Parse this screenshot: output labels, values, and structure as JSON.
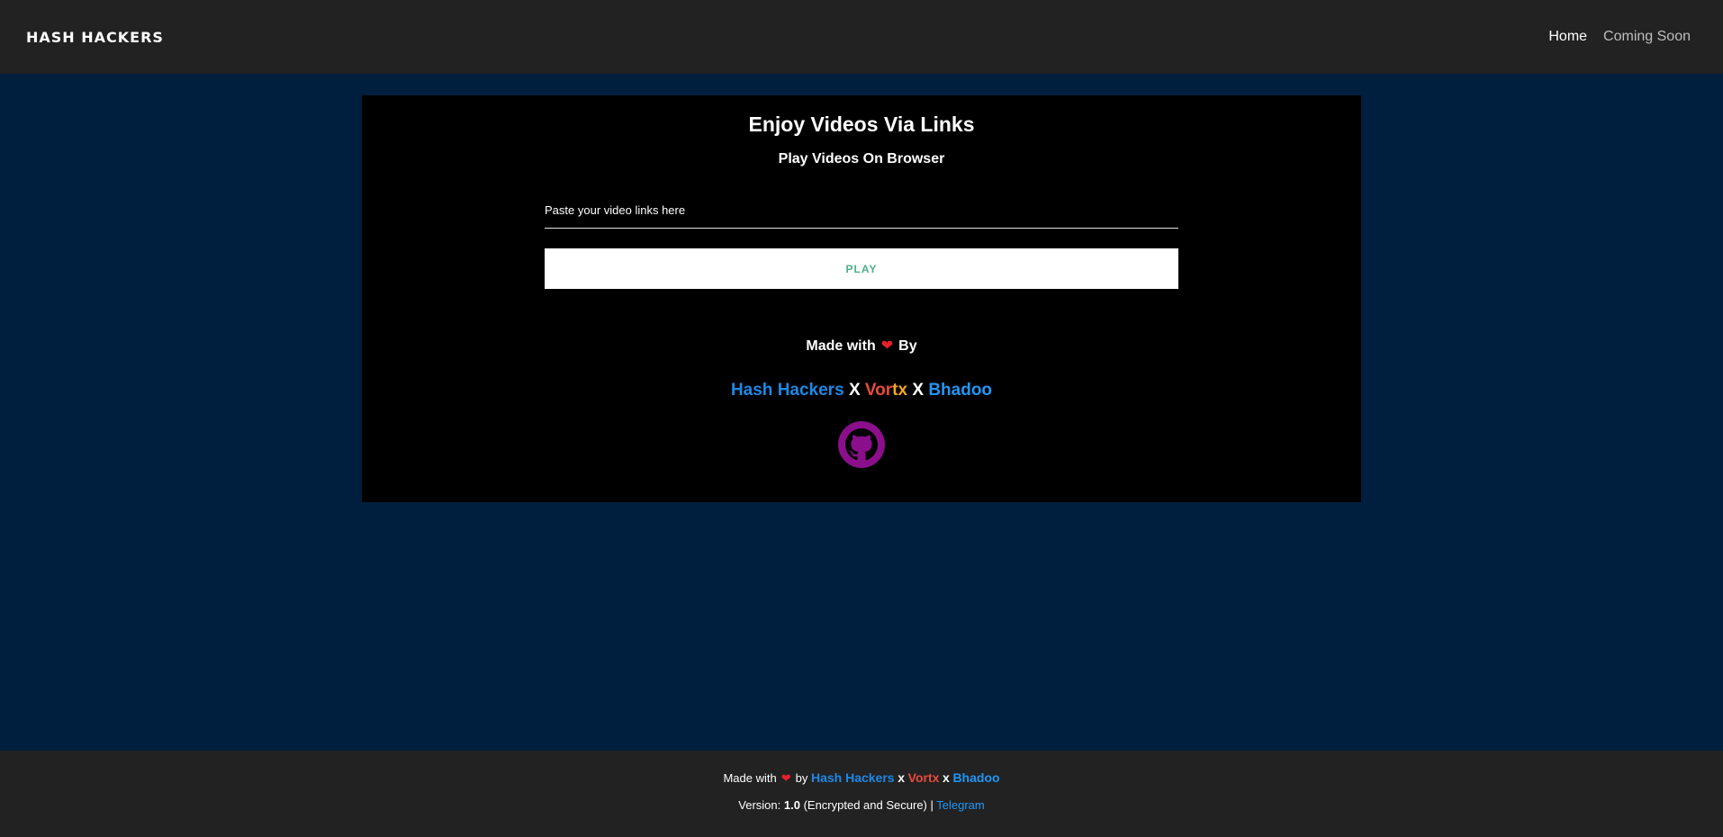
{
  "nav": {
    "brand": "HASH HACKERS",
    "links": [
      "Home",
      "Coming Soon"
    ]
  },
  "main": {
    "title": "Enjoy Videos Via Links",
    "subtitle": "Play Videos On Browser",
    "input_placeholder": "Paste your video links here",
    "input_value": "",
    "play_label": "PLAY",
    "made_with": "Made with",
    "by": "By",
    "credits": {
      "hash": "Hash Hackers",
      "x": "X",
      "vortx_head": "Vor",
      "vortx_tail": "tx",
      "bhadoo": "Bhadoo"
    },
    "github_icon": "github-icon"
  },
  "footer": {
    "made_with": "Made with",
    "by": "by",
    "hash": "Hash Hackers",
    "x": "x",
    "vortx": "Vortx",
    "bhadoo": "Bhadoo",
    "version_prefix": "Version:",
    "version": "1.0",
    "version_suffix": "(Encrypted and Secure) |",
    "telegram": "Telegram"
  },
  "colors": {
    "page_bg": "#001f3f",
    "bar_bg": "#222222",
    "card_bg": "#000000",
    "heart": "#e8202a",
    "link_blue": "#2196f3",
    "play_text": "#4caf8a",
    "github": "#8b0f8b"
  }
}
